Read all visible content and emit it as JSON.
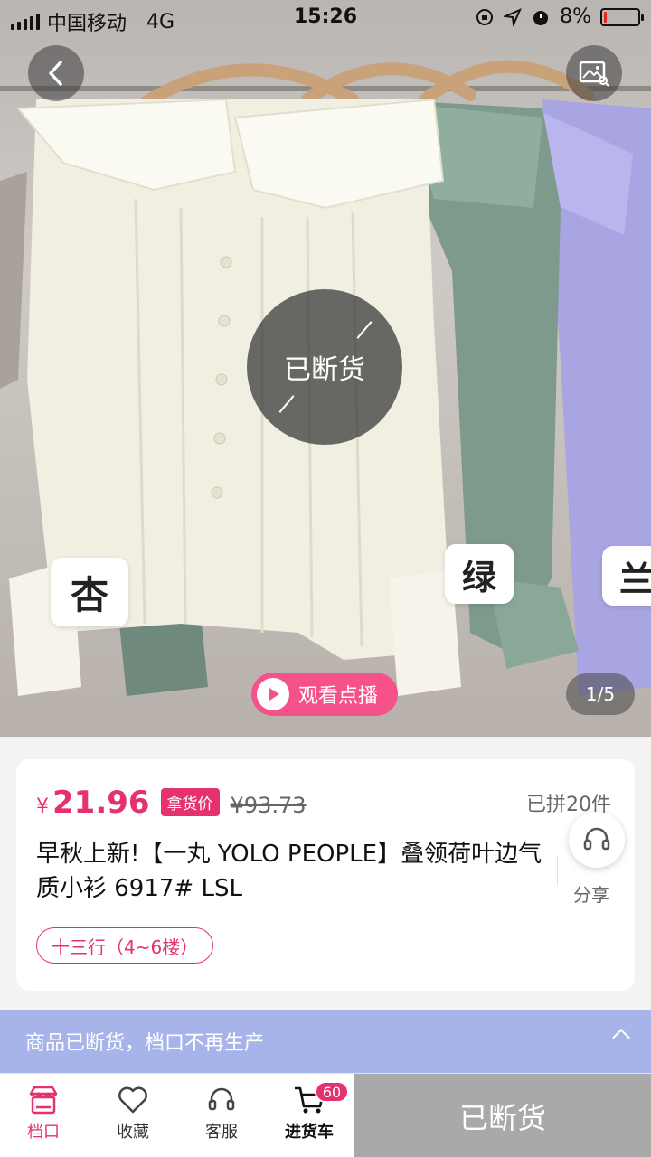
{
  "status_bar": {
    "carrier": "中国移动",
    "network": "4G",
    "time": "15:26",
    "battery": "8%",
    "battery_level": 0.08
  },
  "gallery": {
    "sold_out_overlay": "已断货",
    "colors": [
      "杏",
      "绿",
      "兰"
    ],
    "watch_live_label": "观看点播",
    "counter": "1/5"
  },
  "product": {
    "currency": "¥",
    "price": "21.96",
    "price_badge": "拿货价",
    "original_price": "¥93.73",
    "sold_count": "已拼20件",
    "title": "早秋上新!【一丸 YOLO PEOPLE】叠领荷叶边气质小衫  6917#  LSL",
    "share_label": "分享",
    "location": "十三行（4~6楼）"
  },
  "banner": {
    "text": "商品已断货，档口不再生产"
  },
  "bottom_bar": {
    "tabs": [
      {
        "label": "档口",
        "icon": "shop-icon"
      },
      {
        "label": "收藏",
        "icon": "heart-icon"
      },
      {
        "label": "客服",
        "icon": "headset-icon"
      },
      {
        "label": "进货车",
        "icon": "cart-icon"
      }
    ],
    "cart_count": "60",
    "action_button": "已断货"
  },
  "colors": {
    "accent": "#e5326e",
    "banner_bg": "#a7b4ea",
    "disabled_button": "#a9a9a9"
  }
}
